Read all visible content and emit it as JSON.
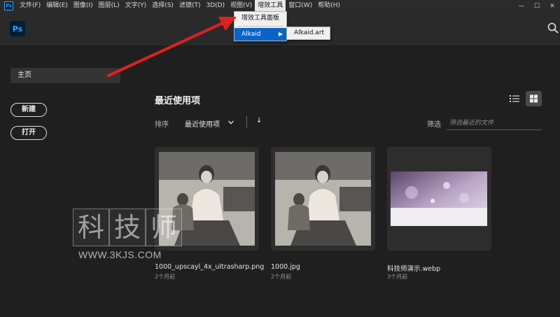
{
  "menubar": {
    "app_badge": "Ps",
    "items": [
      "文件(F)",
      "编辑(E)",
      "图像(I)",
      "图层(L)",
      "文字(Y)",
      "选择(S)",
      "滤镜(T)",
      "3D(D)",
      "视图(V)",
      "增效工具",
      "窗口(W)",
      "帮助(H)"
    ],
    "active_index": 9
  },
  "window_controls": {
    "minimize": "—",
    "maximize": "☐",
    "close": "✕"
  },
  "plugins_menu": {
    "items": [
      "增效工具面板",
      "Alkaid"
    ],
    "selected": "Alkaid",
    "submenu_arrow": "▶",
    "submenu_item": "Alkaid.art"
  },
  "header": {
    "logo": "Ps",
    "search_icon": "search-icon"
  },
  "sidebar": {
    "home": "主页",
    "new_button": "新建",
    "open_button": "打开"
  },
  "main": {
    "title": "最近使用项",
    "sort_label": "排序",
    "sort_value": "最近使用项",
    "sort_direction": "↓",
    "filter_label": "筛选",
    "filter_placeholder": "筛选最近的文件"
  },
  "files": [
    {
      "name": "1000_upscayl_4x_ultrasharp.png",
      "date": "2个月前"
    },
    {
      "name": "1000.jpg",
      "date": "2个月前"
    },
    {
      "name": "科技师演示.webp",
      "date": "3个月前"
    }
  ],
  "watermark": {
    "chars": [
      "科",
      "技",
      "师"
    ],
    "url": "WWW.3KJS.COM"
  },
  "colors": {
    "background": "#1f1f1f",
    "menu_highlight": "#0a64c8",
    "annotation_arrow": "#e02020",
    "ps_blue": "#31a8ff"
  }
}
